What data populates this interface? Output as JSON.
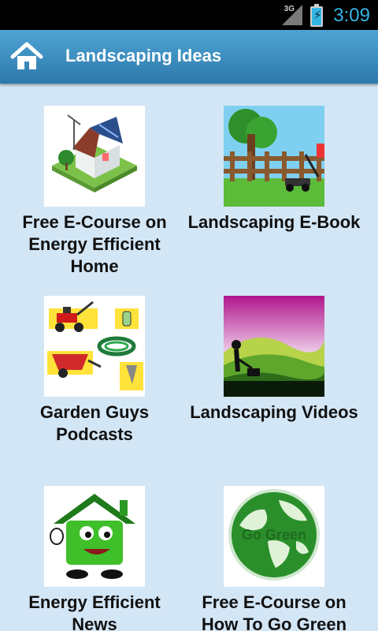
{
  "status_bar": {
    "network": "3G",
    "time": "3:09"
  },
  "action_bar": {
    "title": "Landscaping Ideas",
    "home_icon": "home-icon"
  },
  "items": [
    {
      "label": "Free E-Course on Energy Efficient Home",
      "icon": "eco-house-icon"
    },
    {
      "label": "Landscaping E-Book",
      "icon": "lawn-mower-fence-icon"
    },
    {
      "label": "Garden Guys Podcasts",
      "icon": "garden-tools-icon"
    },
    {
      "label": "Landscaping Videos",
      "icon": "mowing-hills-icon"
    },
    {
      "label": "Energy Efficient News",
      "icon": "green-house-character-icon"
    },
    {
      "label": "Free E-Course on How To Go Green",
      "icon": "go-green-globe-icon",
      "badge_text": "Go Green"
    }
  ],
  "colors": {
    "accent": "#33b5e5",
    "action_bar_top": "#4ea4d4",
    "action_bar_bottom": "#2e79ac",
    "background": "#d3e6f6"
  }
}
